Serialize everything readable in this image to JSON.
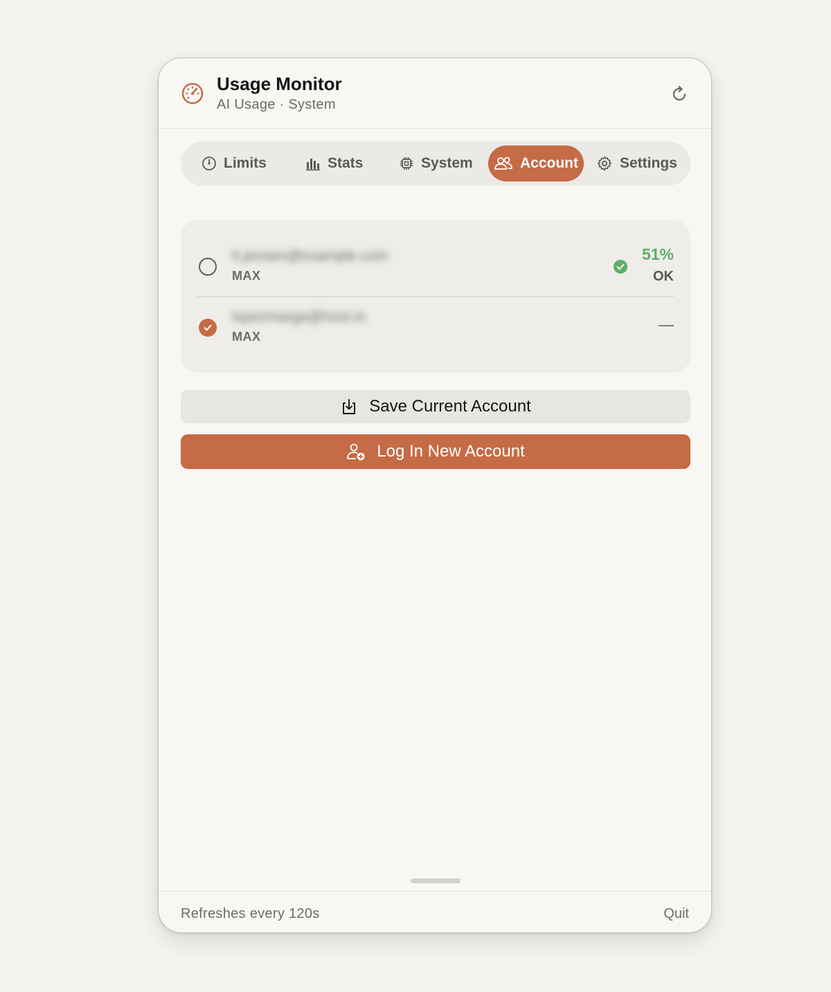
{
  "header": {
    "title": "Usage Monitor",
    "subtitle": "AI Usage · System",
    "app_icon": "gauge-icon",
    "refresh_icon": "refresh-icon"
  },
  "tabs": [
    {
      "label": "Limits",
      "icon": "gauge-icon",
      "active": false
    },
    {
      "label": "Stats",
      "icon": "bar-chart-icon",
      "active": false
    },
    {
      "label": "System",
      "icon": "cpu-icon",
      "active": false
    },
    {
      "label": "Account",
      "icon": "users-icon",
      "active": true
    },
    {
      "label": "Settings",
      "icon": "gear-icon",
      "active": false
    }
  ],
  "accounts": [
    {
      "email": "h.jensen@example.com",
      "plan": "MAX",
      "selected": false,
      "usage_percent": "51%",
      "status": "OK",
      "status_icon": "check-circle-icon"
    },
    {
      "email": "lopezmarga@host.in",
      "plan": "MAX",
      "selected": true,
      "usage_placeholder": "—"
    }
  ],
  "buttons": {
    "save_label": "Save Current Account",
    "login_label": "Log In New Account"
  },
  "footer": {
    "refresh_text": "Refreshes every 120s",
    "quit_label": "Quit"
  },
  "colors": {
    "accent": "#c56b46",
    "ok_green": "#5fae68",
    "background": "#f8f7f3"
  }
}
